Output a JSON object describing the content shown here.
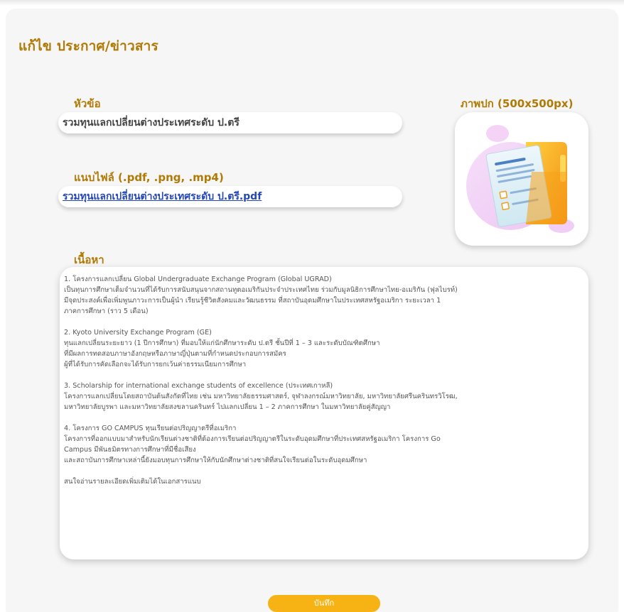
{
  "page": {
    "title": "แก้ไข ประกาศ/ข่าวสาร"
  },
  "fields": {
    "title_label": "หัวข้อ",
    "title_value": "รวมทุนแลกเปลี่ยนต่างประเทศระดับ ป.ตรี",
    "file_label": "แนบไฟล์ (.pdf, .png, .mp4)",
    "file_link": "รวมทุนแลกเปลี่ยนต่างประเทศระดับ ป.ตรี.pdf",
    "cover_label": "ภาพปก (500x500px)",
    "content_label": "เนื้อหา"
  },
  "content": {
    "paragraphs": [
      {
        "lines": [
          "1. โครงการแลกเปลี่ยน Global Undergraduate Exchange Program (Global UGRAD)",
          "เป็นทุนการศึกษาเต็มจำนวนที่ได้รับการสนับสนุนจากสถานทูตอเมริกันประจำประเทศไทย ร่วมกับมูลนิธิการศึกษาไทย-อเมริกัน (ฟุลไบรท์)",
          "มีจุดประสงค์เพื่อเพิ่มพูนภาวะการเป็นผู้นำ เรียนรู้ชีวิตสังคมและวัฒนธรรม ที่สถาบันอุดมศึกษาในประเทศสหรัฐอเมริกา ระยะเวลา 1",
          "ภาคการศึกษา (ราว 5 เดือน)"
        ]
      },
      {
        "lines": [
          "2. Kyoto University Exchange Program (GE)",
          "ทุนแลกเปลี่ยนระยะยาว (1 ปีการศึกษา) ที่มอบให้แก่นักศึกษาระดับ ป.ตรี ชั้นปีที่ 1 – 3 และระดับบัณฑิตศึกษา",
          "ที่มีผลการทดสอบภาษาอังกฤษหรือภาษาญี่ปุ่นตามที่กำหนดประกอบการสมัคร",
          "ผู้ที่ได้รับการคัดเลือกจะได้รับการยกเว้นค่าธรรมเนียมการศึกษา"
        ]
      },
      {
        "lines": [
          "3. Scholarship for international exchange students of excellence (ประเทศเกาหลี)",
          "โครงการแลกเปลี่ยนโดยสถาบันต้นสังกัดที่ไทย เช่น มหาวิทยาลัยธรรมศาสตร์, จุฬาลงกรณ์มหาวิทยาลัย, มหาวิทยาลัยศรีนครินทรวิโรฒ,",
          "มหาวิทยาลัยบูรพา และมหาวิทยาลัยสงขลานครินทร์ ไปแลกเปลี่ยน 1 – 2 ภาคการศึกษา ในมหาวิทยาลัยคู่สัญญา"
        ]
      },
      {
        "lines": [
          "4. โครงการ GO CAMPUS ทุนเรียนต่อปริญญาตรีที่อเมริกา",
          "โครงการที่ออกแบบมาสำหรับนักเรียนต่างชาติที่ต้องการเรียนต่อปริญญาตรีในระดับอุดมศึกษาที่ประเทศสหรัฐอเมริกา โครงการ Go",
          "Campus มีพันธมิตรทางการศึกษาที่มีชื่อเสียง",
          "และสถาบันการศึกษาเหล่านี้ยังมอบทุนการศึกษาให้กับนักศึกษาต่างชาติที่สนใจเรียนต่อในระดับอุดมศึกษา"
        ]
      },
      {
        "lines": [
          "สนใจอ่านรายละเอียดเพิ่มเติมได้ในเอกสารแนบ"
        ]
      }
    ]
  },
  "actions": {
    "save_label": "บันทึก"
  },
  "colors": {
    "accent": "#b07a05",
    "button": "#f7b214",
    "link": "#2448b8"
  }
}
